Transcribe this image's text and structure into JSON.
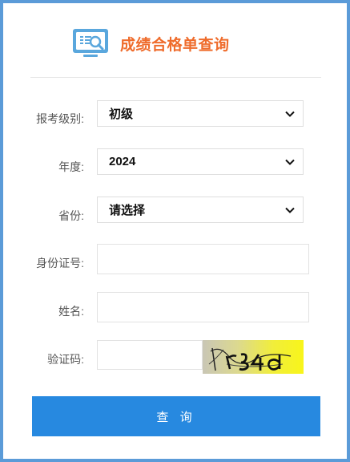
{
  "header": {
    "title": "成绩合格单查询",
    "logo_icon": "search-document-icon"
  },
  "form": {
    "level": {
      "label": "报考级别:",
      "value": "初级"
    },
    "year": {
      "label": "年度:",
      "value": "2024"
    },
    "province": {
      "label": "省份:",
      "value": "请选择"
    },
    "id_number": {
      "label": "身份证号:",
      "value": ""
    },
    "name": {
      "label": "姓名:",
      "value": ""
    },
    "captcha": {
      "label": "验证码:",
      "value": "",
      "image_text": "r34d"
    }
  },
  "query_button": {
    "label": "查 询"
  },
  "colors": {
    "title": "#ef6c2c",
    "button": "#2789e0",
    "frame": "#5b9bd8",
    "captcha_bg": "#f5f21a"
  }
}
